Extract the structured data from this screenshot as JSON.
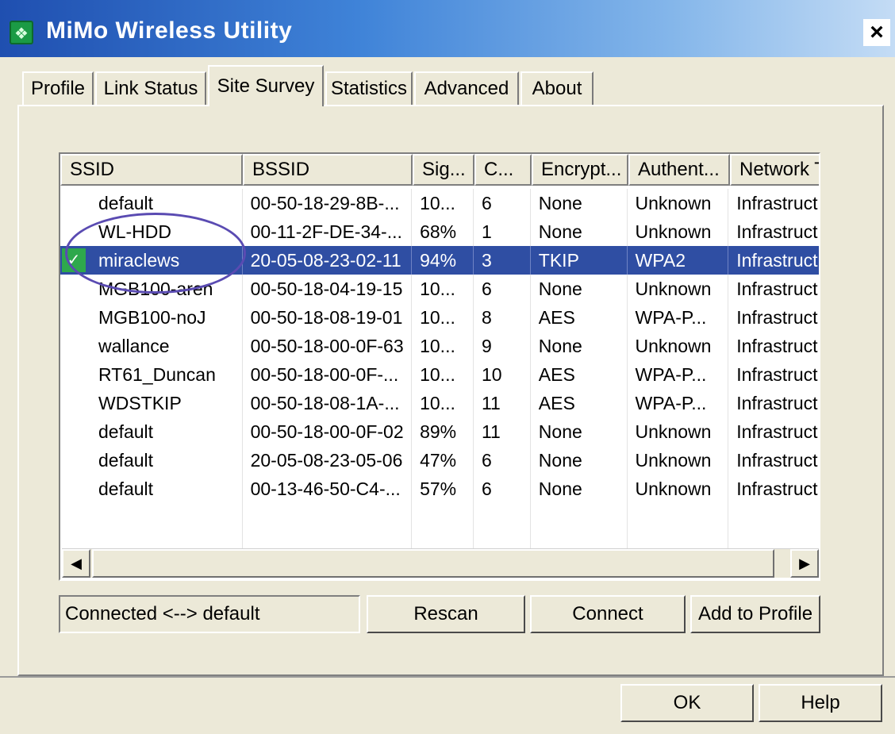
{
  "window": {
    "title": "MiMo Wireless Utility",
    "close_label": "×",
    "icon": "wireless-utility-icon"
  },
  "tabs": [
    {
      "label": "Profile"
    },
    {
      "label": "Link Status"
    },
    {
      "label": "Site Survey",
      "active": true
    },
    {
      "label": "Statistics"
    },
    {
      "label": "Advanced"
    },
    {
      "label": "About"
    }
  ],
  "list": {
    "columns": [
      "SSID",
      "BSSID",
      "Sig...",
      "C...",
      "Encrypt...",
      "Authent...",
      "Network T..."
    ],
    "rows": [
      [
        "default",
        "00-50-18-29-8B-...",
        "10...",
        "6",
        "None",
        "Unknown",
        "Infrastruct..."
      ],
      [
        "WL-HDD",
        "00-11-2F-DE-34-...",
        "68%",
        "1",
        "None",
        "Unknown",
        "Infrastruct..."
      ],
      [
        "miraclews",
        "20-05-08-23-02-11",
        "94%",
        "3",
        "TKIP",
        "WPA2",
        "Infrastruct..."
      ],
      [
        "MGB100-aren",
        "00-50-18-04-19-15",
        "10...",
        "6",
        "None",
        "Unknown",
        "Infrastruct..."
      ],
      [
        "MGB100-noJ",
        "00-50-18-08-19-01",
        "10...",
        "8",
        "AES",
        "WPA-P...",
        "Infrastruct..."
      ],
      [
        "wallance",
        "00-50-18-00-0F-63",
        "10...",
        "9",
        "None",
        "Unknown",
        "Infrastruct..."
      ],
      [
        "RT61_Duncan",
        "00-50-18-00-0F-...",
        "10...",
        "10",
        "AES",
        "WPA-P...",
        "Infrastruct..."
      ],
      [
        "WDSTKIP",
        "00-50-18-08-1A-...",
        "10...",
        "11",
        "AES",
        "WPA-P...",
        "Infrastruct..."
      ],
      [
        "default",
        "00-50-18-00-0F-02",
        "89%",
        "11",
        "None",
        "Unknown",
        "Infrastruct..."
      ],
      [
        "default",
        "20-05-08-23-05-06",
        "47%",
        "6",
        "None",
        "Unknown",
        "Infrastruct..."
      ],
      [
        "default",
        "00-13-46-50-C4-...",
        "57%",
        "6",
        "None",
        "Unknown",
        "Infrastruct..."
      ]
    ],
    "selected_index": 2,
    "selected_icon": "connected-network-icon",
    "scroll_left_glyph": "◀",
    "scroll_right_glyph": "▶"
  },
  "status_text": "Connected <--> default",
  "buttons": {
    "rescan": "Rescan",
    "connect": "Connect",
    "add_to_profile": "Add to Profile",
    "ok": "OK",
    "help": "Help"
  },
  "colors": {
    "selection": "#2f4ea3",
    "annotation_circle": "#5a4bb2"
  }
}
